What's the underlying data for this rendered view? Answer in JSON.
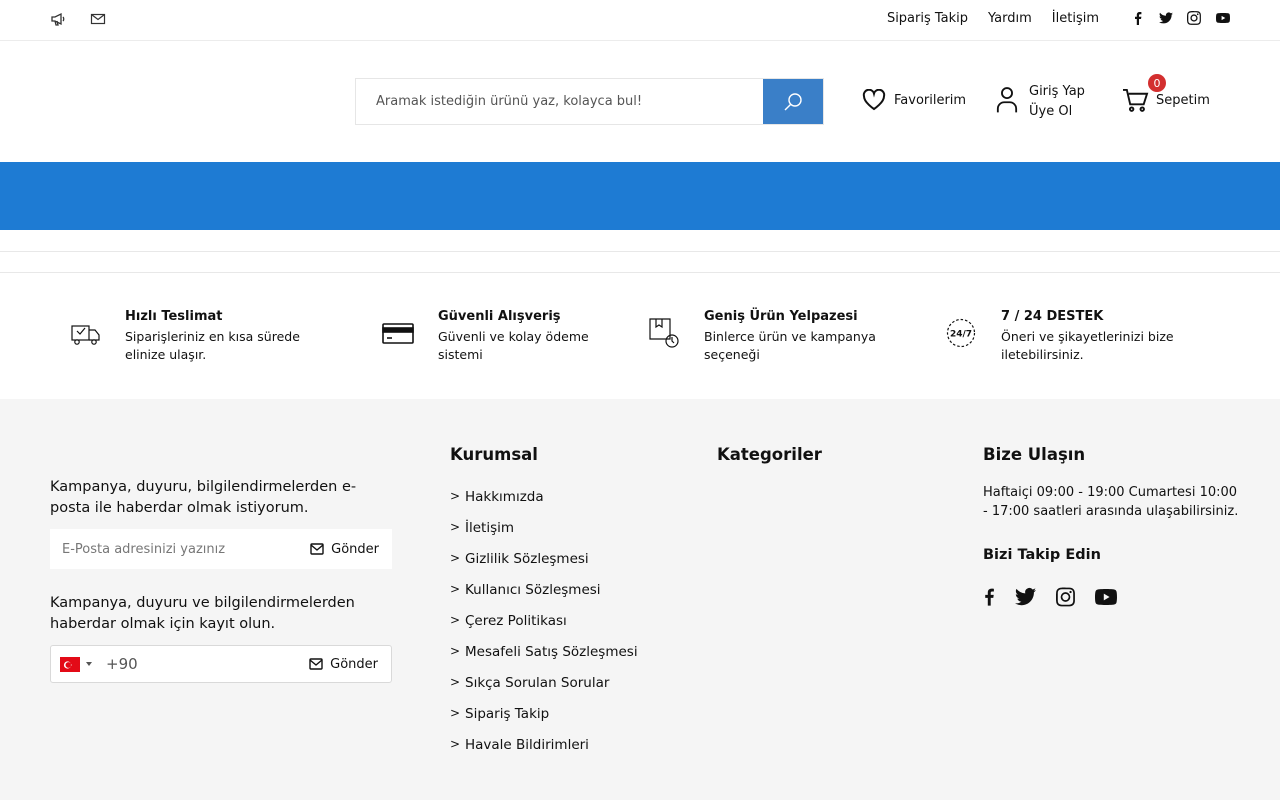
{
  "topbar": {
    "links": [
      "Sipariş Takip",
      "Yardım",
      "İletişim"
    ],
    "icons": [
      "megaphone-icon",
      "mail-icon"
    ],
    "socials": [
      "facebook-icon",
      "twitter-icon",
      "instagram-icon",
      "youtube-icon"
    ]
  },
  "header": {
    "search_placeholder": "Aramak istediğin ürünü yaz, kolayca bul!",
    "favorites_label": "Favorilerim",
    "login_label": "Giriş Yap",
    "register_label": "Üye Ol",
    "cart_label": "Sepetim",
    "cart_count": "0",
    "accent_color": "#3a7fc8",
    "band_color": "#1e7bd3",
    "badge_color": "#d32f2f"
  },
  "features": [
    {
      "title": "Hızlı Teslimat",
      "desc": "Siparişleriniz en kısa sürede elinize ulaşır.",
      "icon": "delivery-truck-icon"
    },
    {
      "title": "Güvenli Alışveriş",
      "desc": "Güvenli ve kolay ödeme sistemi",
      "icon": "credit-card-icon"
    },
    {
      "title": "Geniş Ürün Yelpazesi",
      "desc": "Binlerce ürün ve kampanya seçeneği",
      "icon": "catalog-icon"
    },
    {
      "title": "7 / 24 DESTEK",
      "desc": "Öneri ve şikayetlerinizi bize iletebilirsiniz.",
      "icon": "support-24-7-icon"
    }
  ],
  "footer": {
    "email_text": "Kampanya, duyuru, bilgilendirmelerden e-posta ile haberdar olmak istiyorum.",
    "email_placeholder": "E-Posta adresinizi yazınız",
    "send_label": "Gönder",
    "sms_text": "Kampanya, duyuru ve bilgilendirmelerden haberdar olmak için kayıt olun.",
    "phone_code": "+90",
    "corporate_title": "Kurumsal",
    "corporate_links": [
      "Hakkımızda",
      "İletişim",
      "Gizlilik Sözleşmesi",
      "Kullanıcı Sözleşmesi",
      "Çerez Politikası",
      "Mesafeli Satış Sözleşmesi",
      "Sıkça Sorulan Sorular",
      "Sipariş Takip",
      "Havale Bildirimleri"
    ],
    "categories_title": "Kategoriler",
    "contact_title": "Bize Ulaşın",
    "contact_text": "Haftaiçi 09:00 - 19:00 Cumartesi 10:00 - 17:00 saatleri arasında ulaşabilirsiniz.",
    "follow_title": "Bizi Takip Edin"
  }
}
